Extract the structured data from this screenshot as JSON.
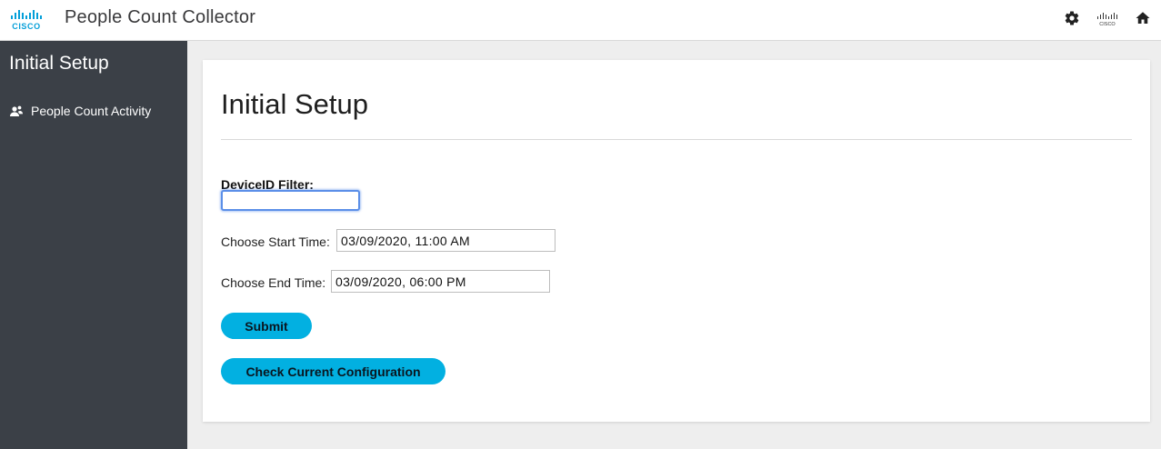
{
  "header": {
    "logo_text": "CISCO",
    "app_title": "People Count Collector",
    "icons": [
      "gear-icon",
      "cisco-logo-icon",
      "home-icon"
    ]
  },
  "sidebar": {
    "title": "Initial Setup",
    "items": [
      {
        "label": "People Count Activity",
        "icon": "people-icon"
      }
    ]
  },
  "main": {
    "title": "Initial Setup",
    "device_filter_label": "DeviceID Filter:",
    "device_filter_value": "",
    "start_label": "Choose Start Time:",
    "start_value": "03/09/2020, 11:00 AM",
    "end_label": "Choose End Time:",
    "end_value": "03/09/2020, 06:00 PM",
    "submit_label": "Submit",
    "check_config_label": "Check Current Configuration"
  },
  "colors": {
    "brand_blue": "#049fd9",
    "button_accent": "#02b0e1",
    "sidebar_bg": "#3b4047",
    "focus_ring": "#5b8fe8"
  }
}
